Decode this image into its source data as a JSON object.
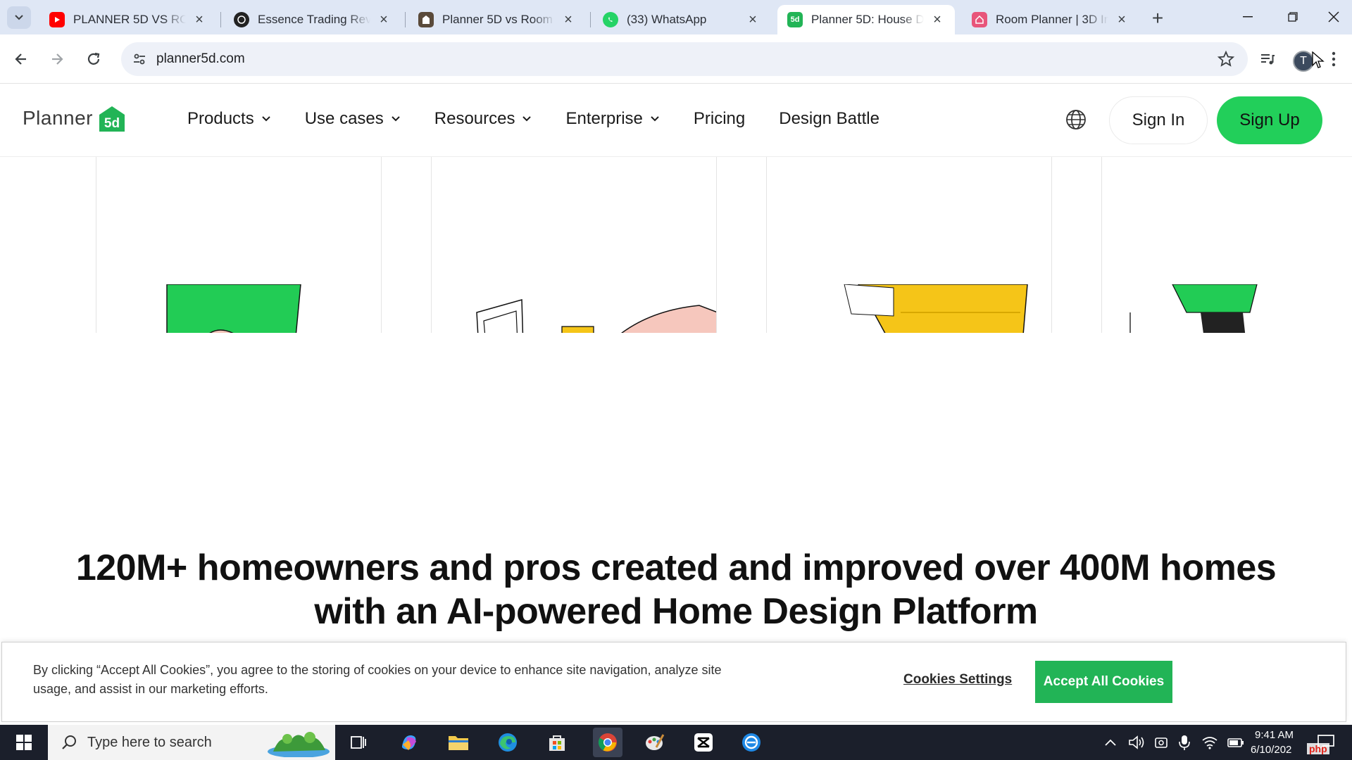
{
  "browser": {
    "tabs": [
      {
        "title": "PLANNER 5D VS ROC",
        "favicon": "youtube-icon",
        "active": false
      },
      {
        "title": "Essence Trading Revi",
        "favicon": "essence-icon",
        "active": false
      },
      {
        "title": "Planner 5D vs Room",
        "favicon": "planner-doc-icon",
        "active": false
      },
      {
        "title": "(33) WhatsApp",
        "favicon": "whatsapp-icon",
        "active": false
      },
      {
        "title": "Planner 5D: House D",
        "favicon": "planner5d-icon",
        "active": true
      },
      {
        "title": "Room Planner | 3D In",
        "favicon": "room-planner-icon",
        "active": false
      }
    ],
    "url": "planner5d.com",
    "profile_initial": "T"
  },
  "site": {
    "logo_text": "Planner",
    "logo_mark": "5d",
    "nav": [
      {
        "label": "Products",
        "dropdown": true
      },
      {
        "label": "Use cases",
        "dropdown": true
      },
      {
        "label": "Resources",
        "dropdown": true
      },
      {
        "label": "Enterprise",
        "dropdown": true
      },
      {
        "label": "Pricing",
        "dropdown": false
      },
      {
        "label": "Design Battle",
        "dropdown": false
      }
    ],
    "sign_in": "Sign In",
    "sign_up": "Sign Up",
    "headline_line1": "120M+ homeowners and pros created and improved over 400M homes",
    "headline_line2": "with an AI-powered Home Design Platform"
  },
  "cookie_banner": {
    "text": "By clicking “Accept All Cookies”, you agree to the storing of cookies on your device to enhance site navigation, analyze site usage, and assist in our marketing efforts.",
    "settings_label": "Cookies Settings",
    "accept_label": "Accept All Cookies"
  },
  "taskbar": {
    "search_placeholder": "Type here to search",
    "time": "9:41 AM",
    "date": "6/10/202"
  },
  "watermark": "php",
  "colors": {
    "brand_green": "#22cf5a",
    "accept_green": "#22b456",
    "tab_strip": "#dfe7f5"
  }
}
